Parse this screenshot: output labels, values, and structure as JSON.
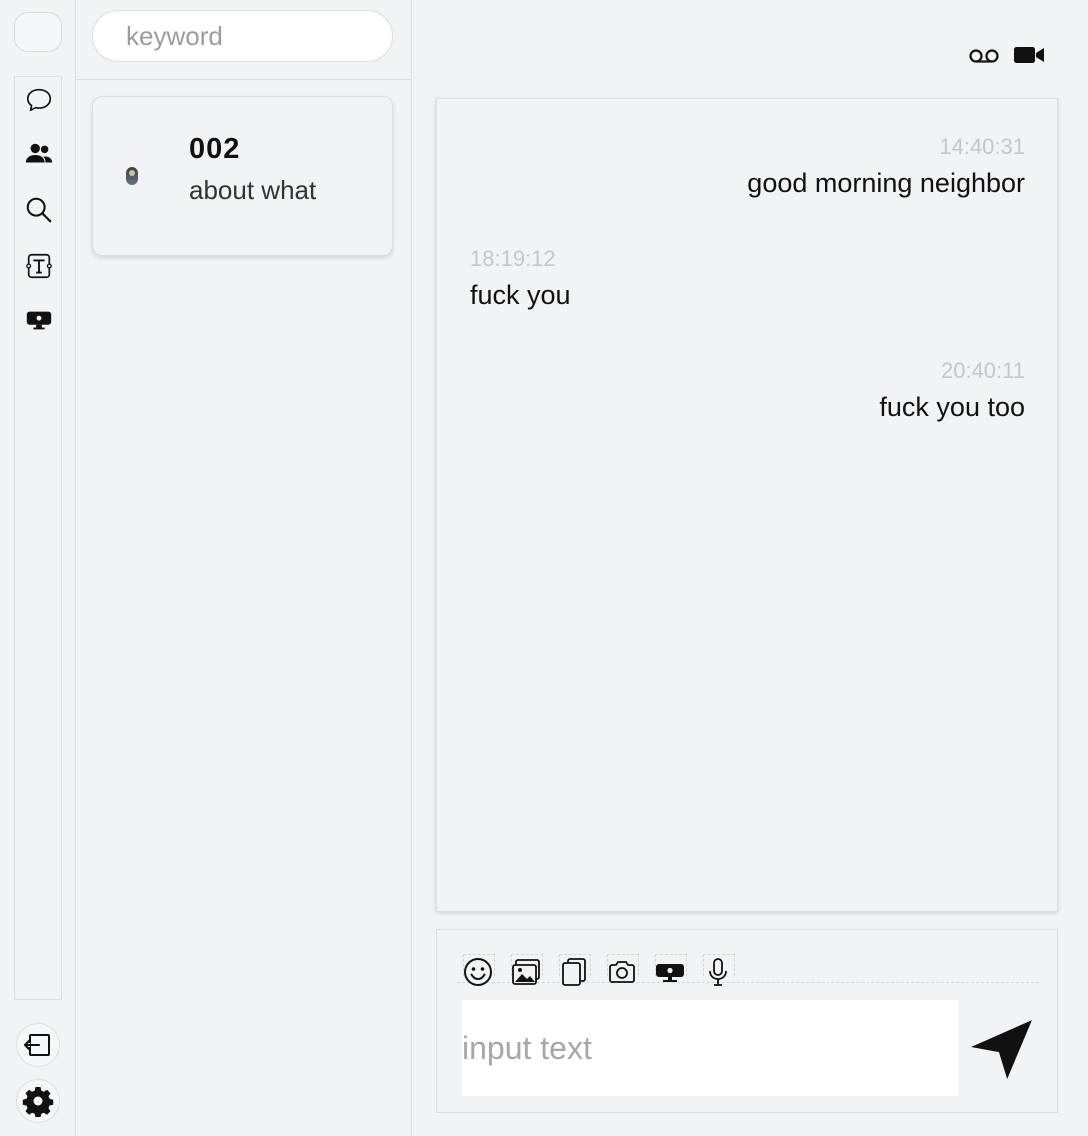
{
  "sidebar": {
    "nav_icons": [
      "chat-bubble-icon",
      "contacts-icon",
      "search-icon",
      "text-format-icon",
      "screen-share-icon"
    ],
    "bottom_icons": [
      "logout-icon",
      "gear-icon"
    ]
  },
  "conversation_list": {
    "search_placeholder": "keyword",
    "items": [
      {
        "name": "002",
        "preview": "about what",
        "avatar": "avatar-image"
      }
    ]
  },
  "chat": {
    "header_icons": [
      "voicemail-icon",
      "video-camera-icon"
    ],
    "messages": [
      {
        "time": "14:40:31",
        "text": "good morning neighbor",
        "side": "right"
      },
      {
        "time": "18:19:12",
        "text": "fuck you",
        "side": "left"
      },
      {
        "time": "20:40:11",
        "text": "fuck you too",
        "side": "right"
      }
    ],
    "composer": {
      "tools": [
        "emoji-icon",
        "image-icon",
        "file-icon",
        "camera-icon",
        "screen-share-icon",
        "microphone-icon"
      ],
      "placeholder": "input text",
      "send_icon": "send-icon"
    }
  },
  "colors": {
    "background": "#f2f3f5",
    "border": "#dcdde0",
    "timestamp": "#c4c6ca",
    "placeholder": "#a5a7ab"
  }
}
